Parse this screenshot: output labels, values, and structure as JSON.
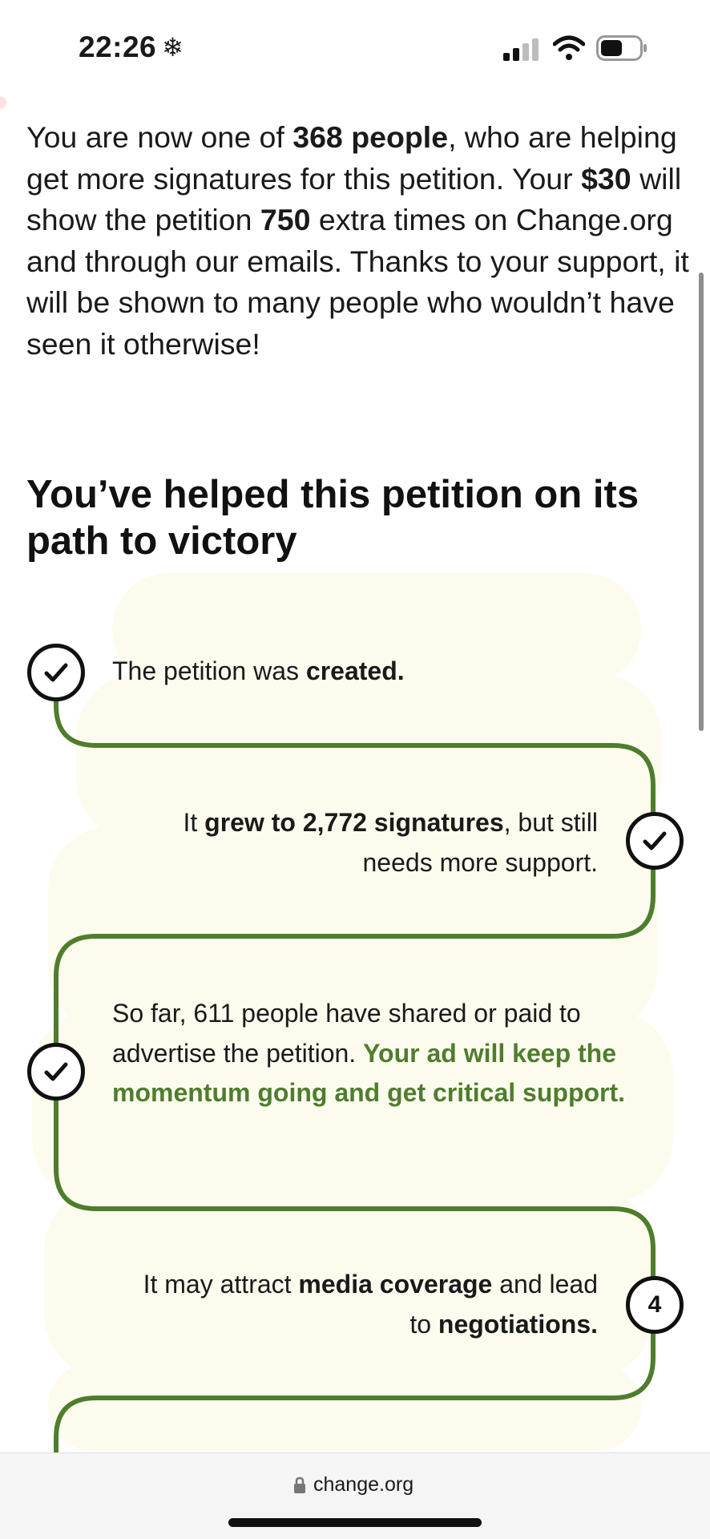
{
  "status_bar": {
    "time": "22:26",
    "extra_icon": "snowflake-icon",
    "icons": [
      "signal-icon",
      "wifi-icon",
      "battery-icon"
    ]
  },
  "intro": {
    "p1": "You are now one of ",
    "people_count": "368 people",
    "p2": ", who are helping get more signatures for this petition. Your ",
    "amount": "$30",
    "p3": " will show the petition ",
    "views": "750",
    "p4": " extra times on Change.org and through our emails. Thanks to your support, it will be shown to many people who wouldn’t have seen it otherwise!"
  },
  "heading": "You’ve helped this petition on its path to victory",
  "steps": [
    {
      "marker": "check-icon",
      "t1": "The petition was ",
      "b1": "created."
    },
    {
      "marker": "check-icon",
      "t1": "It ",
      "b1": "grew to 2,772 signatures",
      "t2": ", but still needs more support."
    },
    {
      "marker": "check-icon",
      "t1": "So far, 611 people have shared or paid to advertise the petition. ",
      "green": "Your ad will keep the momentum going and get critical support."
    },
    {
      "marker_label": "4",
      "t1": "It may attract ",
      "b1": "media coverage",
      "t2": " and lead to ",
      "b2": "negotiations."
    }
  ],
  "colors": {
    "path_green": "#4e7d2e",
    "highlight_bg": "#fdfbee"
  },
  "url_bar": {
    "domain": "change.org",
    "icon": "lock-icon"
  }
}
